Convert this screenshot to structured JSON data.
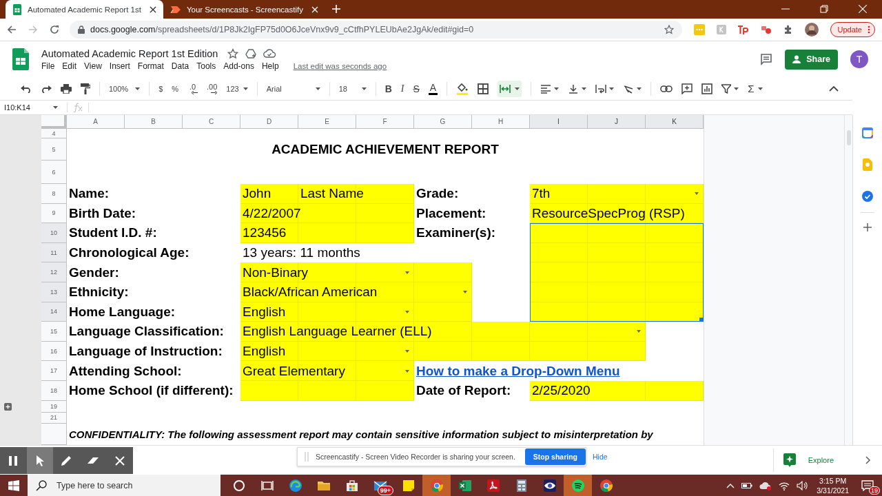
{
  "browser": {
    "tabs": [
      {
        "title": "Automated Academic Report 1st",
        "kind": "sheets",
        "selected": true
      },
      {
        "title": "Your Screencasts - Screencastify",
        "kind": "screencastify",
        "selected": false
      }
    ],
    "address": {
      "domain": "docs.google.com",
      "path": "/spreadsheets/d/1P8Jk2IgFP75d0O6JceVnx9v9_cCtfhPYLEUbAe2JgAk/edit#gid=0"
    },
    "update_button": "Update"
  },
  "document": {
    "title": "Automated Academic Report 1st Edition",
    "menu": [
      "File",
      "Edit",
      "View",
      "Insert",
      "Format",
      "Data",
      "Tools",
      "Add-ons",
      "Help"
    ],
    "last_edit": "Last edit was seconds ago",
    "share_button": "Share",
    "avatar": "T"
  },
  "toolbar": {
    "zoom": "100%",
    "currency": "$",
    "percent": "%",
    "decrease_decimals": ".0",
    "increase_decimals": ".00",
    "number_format": "123",
    "font": "Arial",
    "font_size": "18",
    "bold": "B",
    "italic": "I",
    "strikethrough": "S",
    "text_color": "A",
    "function": "Σ",
    "merge_selected": true
  },
  "formula_bar": {
    "name_box": "I10:K14"
  },
  "sheet": {
    "columns": [
      {
        "label": "A",
        "selected": false
      },
      {
        "label": "B",
        "selected": false
      },
      {
        "label": "C",
        "selected": false
      },
      {
        "label": "D",
        "selected": false
      },
      {
        "label": "E",
        "selected": false
      },
      {
        "label": "F",
        "selected": false
      },
      {
        "label": "G",
        "selected": false
      },
      {
        "label": "H",
        "selected": false
      },
      {
        "label": "I",
        "selected": true
      },
      {
        "label": "J",
        "selected": true
      },
      {
        "label": "K",
        "selected": true
      }
    ],
    "rows": [
      {
        "number": "4",
        "selected": false,
        "cells": []
      },
      {
        "number": "5",
        "selected": false,
        "cells": [
          {
            "highlighted": false
          },
          {
            "highlighted": false
          },
          {
            "highlighted": false
          },
          {
            "highlighted": false
          },
          {
            "highlighted": false
          },
          {
            "kind": "title",
            "text": "ACADEMIC ACHIEVEMENT REPORT",
            "highlighted": false
          },
          {
            "highlighted": false
          },
          {
            "highlighted": false
          },
          {
            "highlighted": false
          },
          {
            "highlighted": false
          },
          {
            "highlighted": false
          }
        ]
      },
      {
        "number": "6",
        "selected": false,
        "cells": []
      },
      {
        "number": "8",
        "selected": false,
        "cells": [
          {
            "kind": "label",
            "text": "Name:",
            "highlighted": false
          },
          {
            "highlighted": false
          },
          {
            "highlighted": false
          },
          {
            "kind": "value",
            "text": "John",
            "highlighted": true
          },
          {
            "kind": "value",
            "text": "Last Name",
            "highlighted": true
          },
          {
            "highlighted": true
          },
          {
            "kind": "label",
            "text": "Grade:",
            "highlighted": false
          },
          {
            "highlighted": false
          },
          {
            "kind": "value",
            "text": "7th",
            "highlighted": true
          },
          {
            "highlighted": true
          },
          {
            "highlighted": true,
            "dropdown": true
          }
        ]
      },
      {
        "number": "9",
        "selected": false,
        "cells": [
          {
            "kind": "label",
            "text": "Birth Date:",
            "highlighted": false
          },
          {
            "highlighted": false
          },
          {
            "highlighted": false
          },
          {
            "kind": "value",
            "text": "4/22/2007",
            "highlighted": true
          },
          {
            "highlighted": true
          },
          {
            "highlighted": true
          },
          {
            "kind": "label",
            "text": "Placement:",
            "highlighted": false
          },
          {
            "highlighted": false
          },
          {
            "kind": "value",
            "text": "ResourceSpecProg (RSP)",
            "highlighted": true
          },
          {
            "highlighted": true
          },
          {
            "highlighted": true
          }
        ]
      },
      {
        "number": "10",
        "selected": true,
        "cells": [
          {
            "kind": "label",
            "text": "Student I.D. #:",
            "highlighted": false
          },
          {
            "highlighted": false
          },
          {
            "highlighted": false
          },
          {
            "kind": "value",
            "text": "123456",
            "highlighted": true
          },
          {
            "highlighted": true
          },
          {
            "highlighted": true
          },
          {
            "kind": "label",
            "text": "Examiner(s):",
            "highlighted": false
          },
          {
            "highlighted": false
          },
          {
            "highlighted": true
          },
          {
            "highlighted": true
          },
          {
            "highlighted": true
          }
        ]
      },
      {
        "number": "11",
        "selected": true,
        "cells": [
          {
            "kind": "label",
            "text": "Chronological Age:",
            "highlighted": false
          },
          {
            "highlighted": false
          },
          {
            "highlighted": false
          },
          {
            "kind": "value",
            "text": "13 years: 11 months",
            "highlighted": false
          },
          {
            "highlighted": false
          },
          {
            "highlighted": false
          },
          {
            "highlighted": false
          },
          {
            "highlighted": false
          },
          {
            "highlighted": true
          },
          {
            "highlighted": true
          },
          {
            "highlighted": true
          }
        ]
      },
      {
        "number": "12",
        "selected": true,
        "cells": [
          {
            "kind": "label",
            "text": "Gender:",
            "highlighted": false
          },
          {
            "highlighted": false
          },
          {
            "highlighted": false
          },
          {
            "kind": "value",
            "text": "Non-Binary",
            "highlighted": true
          },
          {
            "highlighted": true
          },
          {
            "highlighted": true,
            "dropdown": true
          },
          {
            "highlighted": true
          },
          {
            "highlighted": false
          },
          {
            "highlighted": true
          },
          {
            "highlighted": true
          },
          {
            "highlighted": true
          }
        ]
      },
      {
        "number": "13",
        "selected": true,
        "cells": [
          {
            "kind": "label",
            "text": "Ethnicity:",
            "highlighted": false
          },
          {
            "highlighted": false
          },
          {
            "highlighted": false
          },
          {
            "kind": "value",
            "text": "Black/African American",
            "highlighted": true
          },
          {
            "highlighted": true
          },
          {
            "highlighted": true
          },
          {
            "highlighted": true,
            "dropdown": true
          },
          {
            "highlighted": false
          },
          {
            "highlighted": true
          },
          {
            "highlighted": true
          },
          {
            "highlighted": true
          }
        ]
      },
      {
        "number": "14",
        "selected": true,
        "cells": [
          {
            "kind": "label",
            "text": "Home Language:",
            "highlighted": false
          },
          {
            "highlighted": false
          },
          {
            "highlighted": false
          },
          {
            "kind": "value",
            "text": "English",
            "highlighted": true
          },
          {
            "highlighted": true
          },
          {
            "highlighted": true,
            "dropdown": true
          },
          {
            "highlighted": true
          },
          {
            "highlighted": false
          },
          {
            "highlighted": true
          },
          {
            "highlighted": true
          },
          {
            "highlighted": true
          }
        ]
      },
      {
        "number": "15",
        "selected": false,
        "cells": [
          {
            "kind": "label",
            "text": "Language Classification:",
            "highlighted": false
          },
          {
            "highlighted": false
          },
          {
            "highlighted": false
          },
          {
            "kind": "value",
            "text": "English Language Learner (ELL)",
            "highlighted": true
          },
          {
            "highlighted": true
          },
          {
            "highlighted": true
          },
          {
            "highlighted": true
          },
          {
            "highlighted": true
          },
          {
            "highlighted": true
          },
          {
            "highlighted": true,
            "dropdown": true
          },
          {
            "highlighted": false
          }
        ]
      },
      {
        "number": "16",
        "selected": false,
        "cells": [
          {
            "kind": "label",
            "text": "Language of Instruction:",
            "highlighted": false
          },
          {
            "highlighted": false
          },
          {
            "highlighted": false
          },
          {
            "kind": "value",
            "text": "English",
            "highlighted": true
          },
          {
            "highlighted": true
          },
          {
            "highlighted": true,
            "dropdown": true
          },
          {
            "highlighted": true
          },
          {
            "highlighted": true
          },
          {
            "highlighted": true
          },
          {
            "highlighted": true
          },
          {
            "highlighted": false
          }
        ]
      },
      {
        "number": "17",
        "selected": false,
        "cells": [
          {
            "kind": "label",
            "text": "Attending School:",
            "highlighted": false
          },
          {
            "highlighted": false
          },
          {
            "highlighted": false
          },
          {
            "kind": "value",
            "text": "Great Elementary",
            "highlighted": true
          },
          {
            "highlighted": true
          },
          {
            "highlighted": true,
            "dropdown": true
          },
          {
            "kind": "link",
            "text": "How to make a Drop-Down Menu",
            "highlighted": false
          },
          {
            "highlighted": false
          },
          {
            "highlighted": false
          },
          {
            "highlighted": false
          },
          {
            "highlighted": false
          }
        ]
      },
      {
        "number": "18",
        "selected": false,
        "cells": [
          {
            "kind": "label",
            "text": "Home School (if different):",
            "highlighted": false
          },
          {
            "highlighted": false
          },
          {
            "highlighted": false
          },
          {
            "highlighted": true
          },
          {
            "highlighted": true
          },
          {
            "highlighted": true
          },
          {
            "kind": "label",
            "text": "Date of  Report:",
            "highlighted": false
          },
          {
            "highlighted": false
          },
          {
            "kind": "value",
            "text": "2/25/2020",
            "highlighted": true
          },
          {
            "highlighted": true
          },
          {
            "highlighted": true
          }
        ]
      },
      {
        "number": "19",
        "selected": false,
        "cells": []
      },
      {
        "number": "21",
        "selected": false,
        "cells": []
      },
      {
        "selected": false,
        "cells": [
          {
            "kind": "note",
            "text": "CONFIDENTIALITY: The following assessment report may contain sensitive information subject to misinterpretation by",
            "highlighted": false
          },
          {
            "highlighted": false
          },
          {
            "highlighted": false
          },
          {
            "highlighted": false
          },
          {
            "highlighted": false
          },
          {
            "highlighted": false
          },
          {
            "highlighted": false
          },
          {
            "highlighted": false
          },
          {
            "highlighted": false
          },
          {
            "highlighted": false
          },
          {
            "highlighted": false
          }
        ]
      }
    ]
  },
  "screencastify": {
    "tools": [
      {
        "kind": "pause",
        "selected": false
      },
      {
        "kind": "pointer",
        "selected": true
      },
      {
        "kind": "pen",
        "selected": false
      },
      {
        "kind": "eraser",
        "selected": false
      },
      {
        "kind": "close",
        "selected": false
      }
    ]
  },
  "notification": {
    "message": "Screencastify - Screen Video Recorder is sharing your screen.",
    "stop_button": "Stop sharing",
    "hide_link": "Hide"
  },
  "explore_button": "Explore",
  "taskbar": {
    "search_placeholder": "Type here to search",
    "apps": [
      {
        "kind": "cortana",
        "highlighted": false
      },
      {
        "kind": "taskview",
        "highlighted": false
      },
      {
        "kind": "edge",
        "highlighted": false
      },
      {
        "kind": "folder",
        "highlighted": false
      },
      {
        "kind": "store",
        "highlighted": false
      },
      {
        "kind": "mail",
        "highlighted": false,
        "badge": "99+"
      },
      {
        "kind": "notes",
        "highlighted": false
      },
      {
        "kind": "chrome",
        "highlighted": true
      },
      {
        "kind": "excel",
        "highlighted": false
      },
      {
        "kind": "acrobat",
        "highlighted": false
      },
      {
        "kind": "calculator",
        "highlighted": false
      },
      {
        "kind": "eye",
        "highlighted": false
      },
      {
        "kind": "spotify",
        "highlighted": true
      },
      {
        "kind": "chrome",
        "highlighted": false
      }
    ],
    "time": "3:15 PM",
    "date": "3/31/2021",
    "notification_count": "19"
  }
}
